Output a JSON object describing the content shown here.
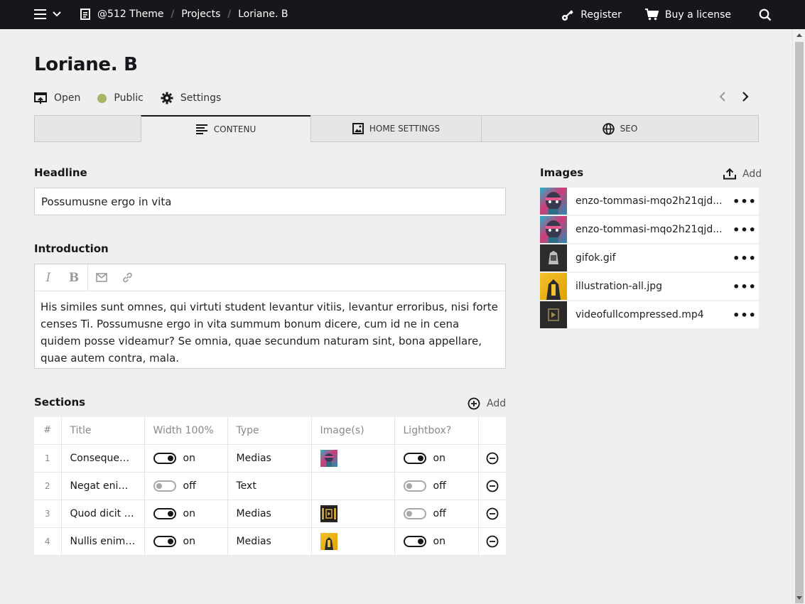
{
  "topbar": {
    "breadcrumbs": [
      "@512 Theme",
      "Projects",
      "Loriane. B"
    ],
    "register_label": "Register",
    "buy_label": "Buy a license"
  },
  "page": {
    "title": "Loriane. B",
    "open_label": "Open",
    "status_label": "Public",
    "status_color": "#a3b860",
    "settings_label": "Settings"
  },
  "tabs": [
    {
      "label": "",
      "icon": "blank"
    },
    {
      "label": "CONTENU",
      "icon": "text-lines-icon",
      "active": true
    },
    {
      "label": "HOME SETTINGS",
      "icon": "image-icon"
    },
    {
      "label": "SEO",
      "icon": "globe-icon"
    }
  ],
  "headline": {
    "label": "Headline",
    "value": "Possumusne ergo in vita"
  },
  "introduction": {
    "label": "Introduction",
    "text": "His similes sunt omnes, qui virtuti student levantur vitiis, levantur erroribus, nisi forte censes Ti. Possumusne ergo in vita summum bonum dicere, cum id ne in cena quidem posse videamur? Se omnia, quae secundum naturam sint, bona appellare, quae autem contra, mala."
  },
  "sections": {
    "label": "Sections",
    "add_label": "Add",
    "columns": [
      "#",
      "Title",
      "Width 100%",
      "Type",
      "Image(s)",
      "Lightbox?"
    ],
    "rows": [
      {
        "num": "1",
        "title": "Consequenti...",
        "width": "on",
        "type": "Medias",
        "image": "colorful-portrait",
        "lightbox": "on"
      },
      {
        "num": "2",
        "title": "Negat enim t...",
        "width": "off",
        "type": "Text",
        "image": "",
        "lightbox": "off"
      },
      {
        "num": "3",
        "title": "Quod dicit E...",
        "width": "on",
        "type": "Medias",
        "image": "video-thumb",
        "lightbox": "off"
      },
      {
        "num": "4",
        "title": "Nullis enim p...",
        "width": "on",
        "type": "Medias",
        "image": "yellow-illustration",
        "lightbox": "on"
      }
    ]
  },
  "images": {
    "label": "Images",
    "add_label": "Add",
    "items": [
      {
        "name": "enzo-tommasi-mqo2h21qjd...",
        "thumb": "colorful-portrait"
      },
      {
        "name": "enzo-tommasi-mqo2h21qjd...",
        "thumb": "colorful-portrait"
      },
      {
        "name": "gifok.gif",
        "thumb": "dark-gif"
      },
      {
        "name": "illustration-all.jpg",
        "thumb": "yellow-illustration"
      },
      {
        "name": "videofullcompressed.mp4",
        "thumb": "video-thumb"
      }
    ]
  }
}
